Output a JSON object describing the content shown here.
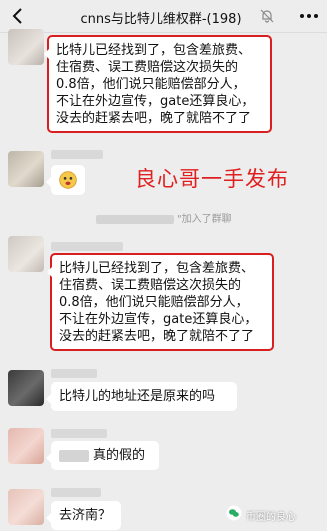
{
  "header": {
    "title": "cnns与比特儿维权群-(198)",
    "back_icon": "chevron-left-icon",
    "mute_icon": "bell-muted-icon",
    "more_icon": "more-icon"
  },
  "messages": [
    {
      "text_lines": [
        "比特儿已经找到了，包含差旅费、",
        "住宿费、误工费赔偿这次损失的",
        "0.8倍，他们说只能赔偿部分人，",
        "不让在外边宣传，gate还算良心，",
        "没去的赶紧去吧，晚了就陪不了了"
      ]
    },
    {
      "sticker_icon": "sticker-face-icon"
    },
    {
      "text_lines": [
        "比特儿已经找到了，包含差旅费、",
        "住宿费、误工费赔偿这次损失的",
        "0.8倍，他们说只能赔偿部分人，",
        "不让在外边宣传，gate还算良心，",
        "没去的赶紧去吧，晚了就陪不了了"
      ]
    },
    {
      "text": "比特儿的地址还是原来的吗"
    },
    {
      "text": "真的假的"
    },
    {
      "text": "去济南？"
    }
  ],
  "overlay": {
    "red_title": "良心哥一手发布"
  },
  "system_note": {
    "text": "\"加入了群聊"
  },
  "watermark": {
    "text": "币圈的良心"
  },
  "colors": {
    "background": "#ededed",
    "highlight_border": "#d81e1e",
    "red_title": "#e02020"
  }
}
